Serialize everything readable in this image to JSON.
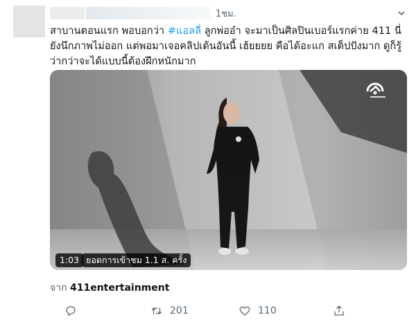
{
  "tweet": {
    "time": "1ชม.",
    "text_before": "สาบานตอนแรก พอบอกว่า ",
    "hashtag": "#แอลลี่",
    "text_after": " ลูกพ่ออ๋า จะมาเป็นศิลปินเบอร์แรกค่าย 411 นี่ยังนึกภาพไม่ออก แต่พอมาเจอคลิปเต้นอันนี้ เฮ้ยยยย คือได้อะแก สเต็ปปังมาก ดูก็รู้ว่ากว่าจะได้แบบนี้ต้องฝึกหนักมาก",
    "video": {
      "duration": "1:03",
      "views": "ยอดการเข้าชม 1.1 ส. ครั้ง"
    },
    "source_prefix": "จาก",
    "source_name": "411entertainment",
    "actions": {
      "reply_count": "",
      "retweet_count": "201",
      "like_count": "110"
    }
  },
  "icons": {
    "more": "chevron-down-icon",
    "reply": "reply-icon",
    "retweet": "retweet-icon",
    "like": "heart-icon",
    "share": "share-icon",
    "logo": "channel-logo-icon"
  },
  "colors": {
    "hashtag": "#1d9bf0",
    "secondary_text": "#536471",
    "primary_text": "#0f1419"
  }
}
